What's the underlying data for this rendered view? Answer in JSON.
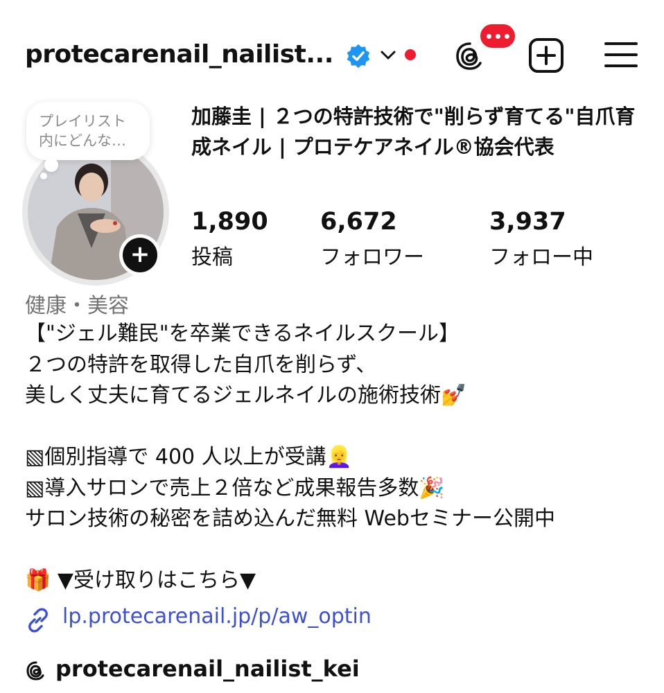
{
  "header": {
    "username": "protecarenail_nailist...",
    "verified_icon": "verified-badge-icon",
    "notification_badge": "•••",
    "icons": [
      "threads-icon",
      "create-plus-icon",
      "menu-icon"
    ],
    "accent_blue": "#1e95f2",
    "badge_red": "#ee1c2e"
  },
  "profile": {
    "note": "プレイリスト\n内にどんな…",
    "display_name": "加藤圭 | ２つの特許技術で\"削らず育てる\"自爪育成ネイル | プロテケアネイル®協会代表",
    "stats": [
      {
        "count": "1,890",
        "label": "投稿"
      },
      {
        "count": "6,672",
        "label": "フォロワー"
      },
      {
        "count": "3,937",
        "label": "フォロー中"
      }
    ],
    "category": "健康・美容",
    "bio": "【\"ジェル難民\"を卒業できるネイルスクール】\n２つの特許を取得した自爪を削らず、\n美しく丈夫に育てるジェルネイルの施術技術💅\n\n▧個別指導で 400 人以上が受講👱‍♀️\n▧導入サロンで売上２倍など成果報告多数🎉\nサロン技術の秘密を詰め込んだ無料 Webセミナー公開中\n\n🎁 ▼受け取りはこちら▼",
    "link": "lp.protecarenail.jp/p/aw_optin",
    "threads_handle": "protecarenail_nailist_kei",
    "link_color": "#3b4fd8"
  }
}
